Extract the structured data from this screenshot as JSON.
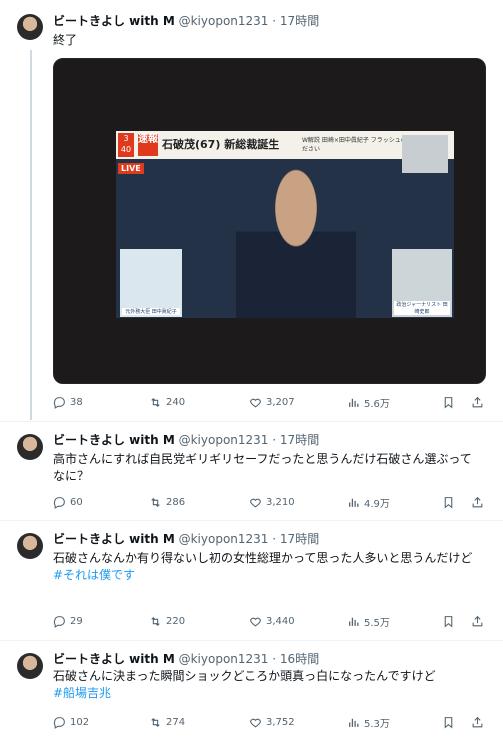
{
  "author": {
    "name": "ビートきよし with M",
    "handle": "@kiyopon1231"
  },
  "tweets": [
    {
      "time": "17時間",
      "text": "終了",
      "hashtag": "",
      "stats": {
        "replies": "38",
        "reposts": "240",
        "likes": "3,207",
        "views": "5.6万"
      },
      "media": {
        "channel": "3 40",
        "flash": "速報",
        "headline": "石破茂(67) 新総裁誕生",
        "subcaption": "W解説 田崎×田中眞紀子 フラッシュの点滅にご注意ください",
        "live": "LIVE",
        "pip_left_label": "元外務大臣 田中眞紀子",
        "pip_right_label": "政治ジャーナリスト 田崎史郎"
      }
    },
    {
      "time": "17時間",
      "text": "高市さんにすれば自民党ギリギリセーフだったと思うんだけ石破さん選ぶってなに？",
      "hashtag": "",
      "stats": {
        "replies": "60",
        "reposts": "286",
        "likes": "3,210",
        "views": "4.9万"
      }
    },
    {
      "time": "17時間",
      "text": "石破さんなんか有り得ないし初の女性総理かって思った人多いと思うんだけど",
      "hashtag": "#それは僕です",
      "stats": {
        "replies": "29",
        "reposts": "220",
        "likes": "3,440",
        "views": "5.5万"
      }
    },
    {
      "time": "16時間",
      "text": "石破さんに決まった瞬間ショックどころか頭真っ白になったんですけど",
      "hashtag": "#船場吉兆",
      "stats": {
        "replies": "102",
        "reposts": "274",
        "likes": "3,752",
        "views": "5.3万"
      }
    }
  ]
}
